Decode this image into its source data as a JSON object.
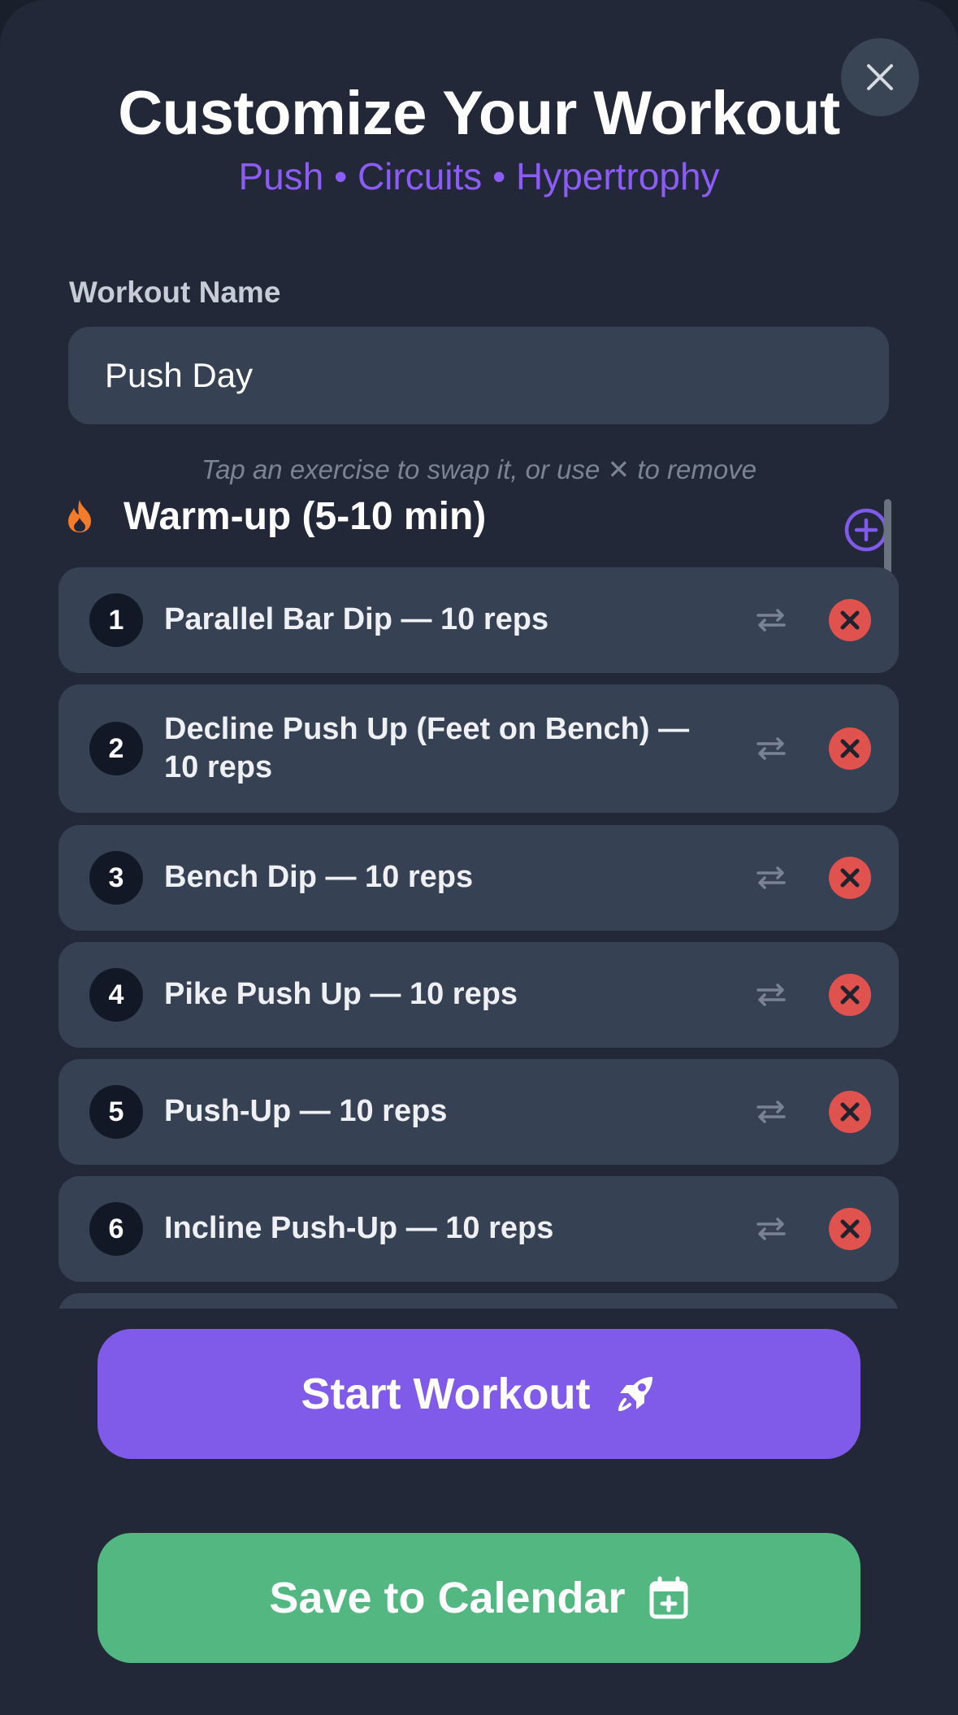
{
  "header": {
    "title": "Customize Your Workout",
    "subtitle": "Push • Circuits • Hypertrophy"
  },
  "form": {
    "name_label": "Workout Name",
    "name_value": "Push Day"
  },
  "hint": "Tap an exercise to swap it, or use ✕ to remove",
  "section": {
    "title": "Warm-up (5-10 min)",
    "icon": "fire-icon"
  },
  "exercises": [
    {
      "number": "1",
      "text": "Parallel Bar Dip — 10 reps"
    },
    {
      "number": "2",
      "text": "Decline Push Up (Feet on Bench) — 10 reps"
    },
    {
      "number": "3",
      "text": "Bench Dip — 10 reps"
    },
    {
      "number": "4",
      "text": "Pike Push Up — 10 reps"
    },
    {
      "number": "5",
      "text": "Push-Up — 10 reps"
    },
    {
      "number": "6",
      "text": "Incline Push-Up — 10 reps"
    }
  ],
  "actions": {
    "start_label": "Start Workout",
    "save_label": "Save to Calendar"
  },
  "colors": {
    "accent": "#805ae8",
    "success": "#53b782",
    "danger": "#e0524d",
    "surface": "#364153",
    "background": "#222838"
  }
}
